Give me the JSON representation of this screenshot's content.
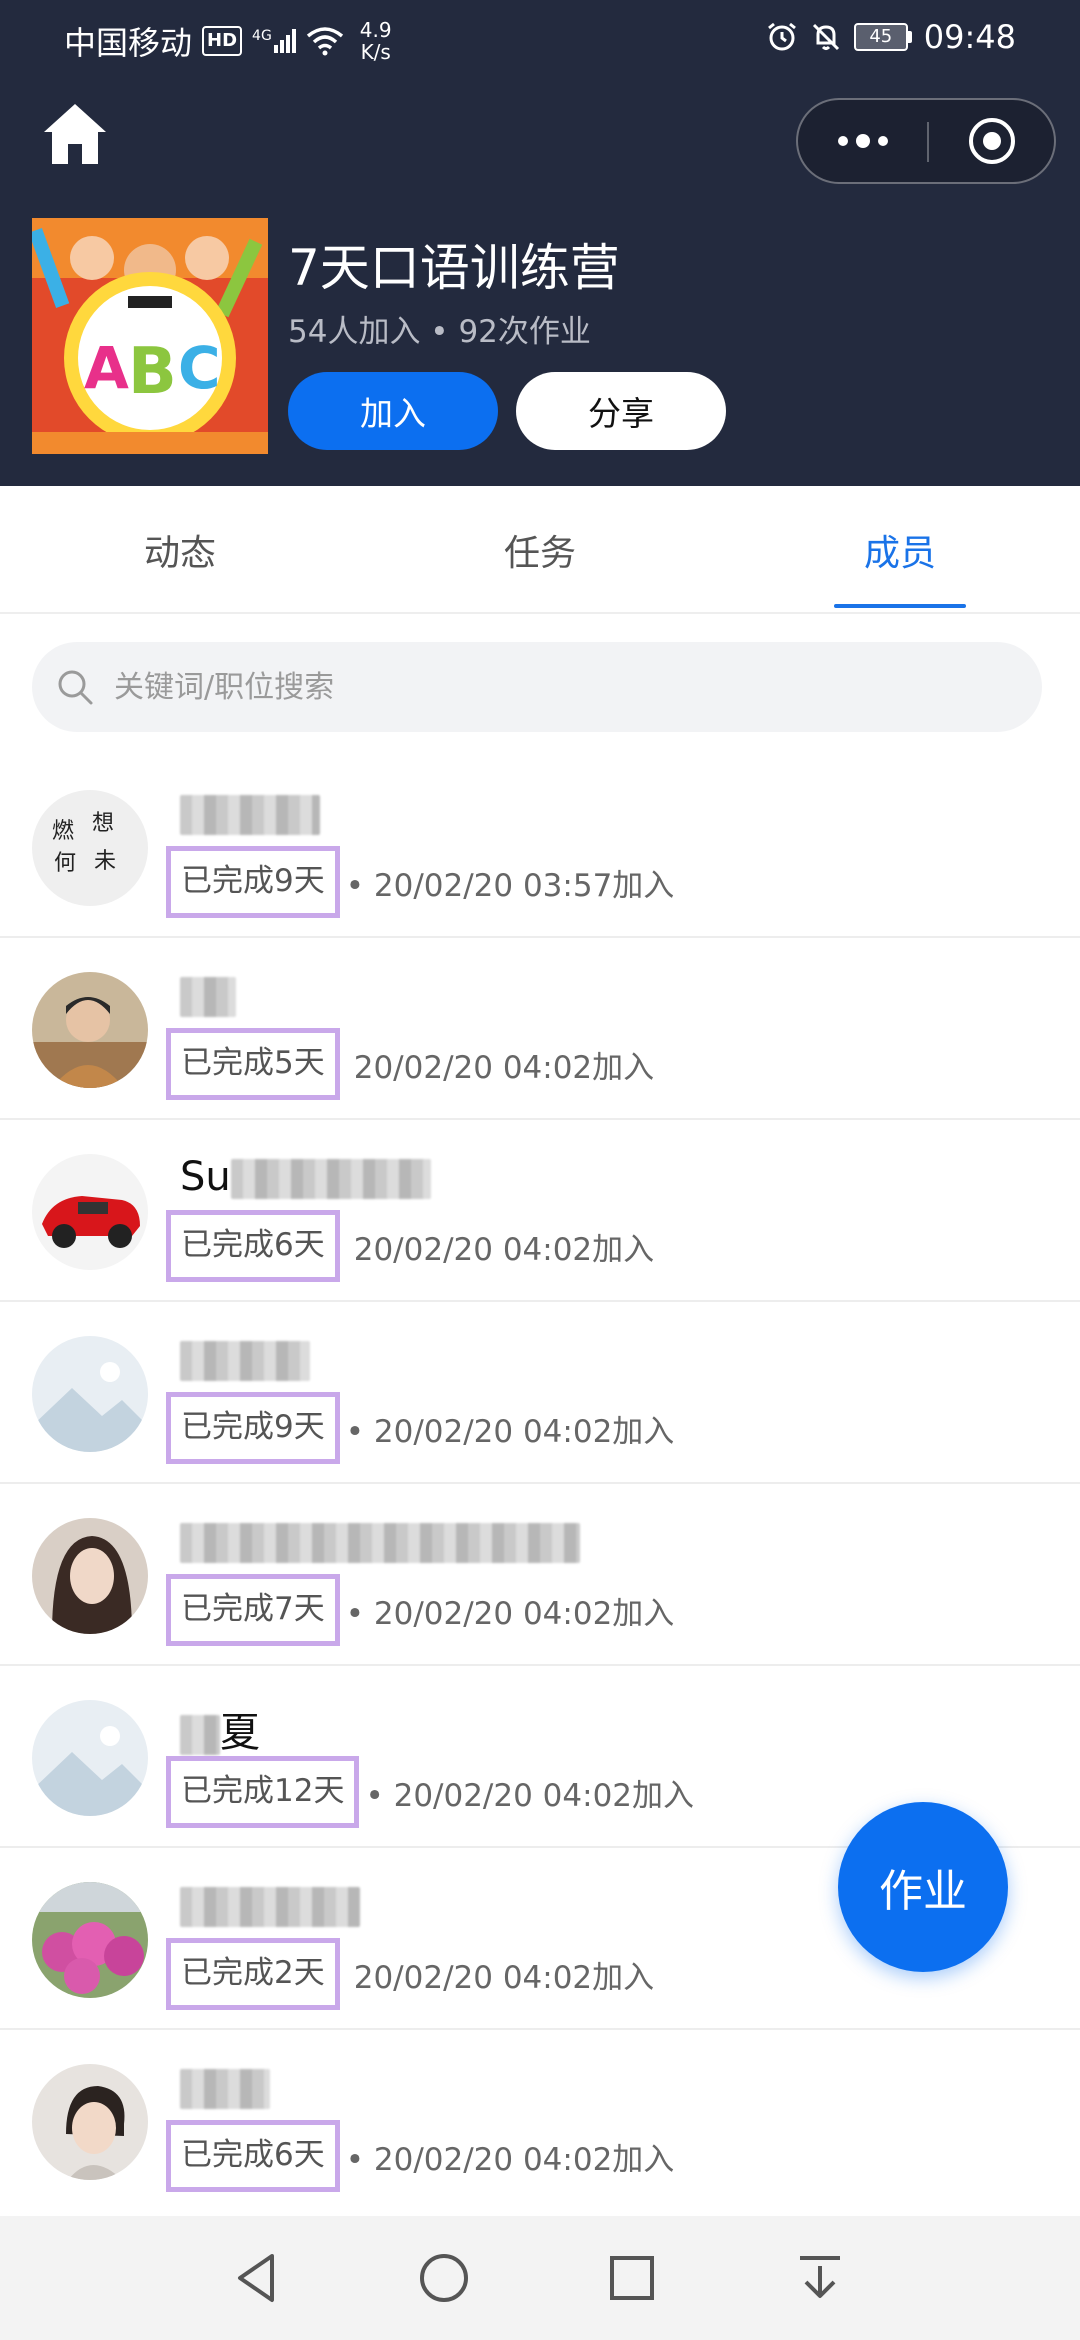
{
  "status_bar": {
    "carrier": "中国移动",
    "hd": "HD",
    "signal_type": "4G",
    "speed_value": "4.9",
    "speed_unit": "K/s",
    "battery": "45",
    "time": "09:48",
    "icons": [
      "signal-icon",
      "wifi-icon",
      "alarm-icon",
      "mute-bell-icon",
      "battery-icon"
    ]
  },
  "header": {
    "home_icon": "home-icon",
    "capsule": {
      "more_icon": "more-dots-icon",
      "close_icon": "target-close-icon"
    },
    "camp": {
      "title": "7天口语训练营",
      "stats": "54人加入 • 92次作业",
      "join_label": "加入",
      "share_label": "分享"
    }
  },
  "tabs": [
    {
      "label": "动态",
      "active": false
    },
    {
      "label": "任务",
      "active": false
    },
    {
      "label": "成员",
      "active": true
    }
  ],
  "search": {
    "placeholder": "关键词/职位搜索",
    "value": ""
  },
  "members": [
    {
      "name": "",
      "done": "已完成9天",
      "joined": " • 20/02/20 03:57加入",
      "avatar": "calligraphy"
    },
    {
      "name": "",
      "done": "已完成5天",
      "joined": "20/02/20 04:02加入",
      "avatar": "person"
    },
    {
      "name": "Su",
      "done": "已完成6天",
      "joined": "20/02/20 04:02加入",
      "avatar": "car"
    },
    {
      "name": "",
      "done": "已完成9天",
      "joined": " • 20/02/20 04:02加入",
      "avatar": "placeholder"
    },
    {
      "name": "",
      "done": "已完成7天",
      "joined": " • 20/02/20 04:02加入",
      "avatar": "girl"
    },
    {
      "name": "夏",
      "done": "已完成12天",
      "joined": " • 20/02/20 04:02加入",
      "avatar": "placeholder"
    },
    {
      "name": "",
      "done": "已完成2天",
      "joined": "20/02/20 04:02加入",
      "avatar": "flowers"
    },
    {
      "name": "",
      "done": "已完成6天",
      "joined": " • 20/02/20 04:02加入",
      "avatar": "woman"
    }
  ],
  "fab": {
    "label": "作业"
  },
  "nav_bar": {
    "icons": [
      "back-icon",
      "home-circle-icon",
      "recents-icon",
      "notification-pull-icon"
    ]
  },
  "colors": {
    "header_bg": "#232a3e",
    "accent": "#0c6ff0",
    "badge_outline": "#c9a8ea"
  }
}
